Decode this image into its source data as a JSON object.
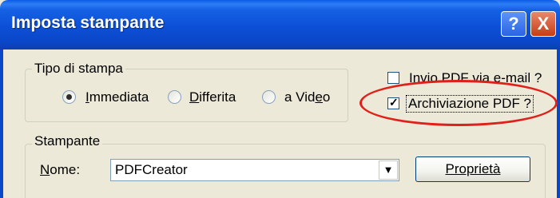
{
  "window": {
    "title": "Imposta stampante",
    "help_symbol": "?",
    "close_symbol": "X"
  },
  "print_type": {
    "label": "Tipo di stampa",
    "options": [
      {
        "label": "Immediata",
        "selected": true
      },
      {
        "label": "Differita",
        "selected": false
      },
      {
        "label": "a Video",
        "selected": false
      }
    ]
  },
  "options": {
    "send_pdf_email": {
      "label": "Invio PDF via e-mail ?",
      "checked": false
    },
    "archive_pdf": {
      "label": "Archiviazione PDF ?",
      "checked": true
    }
  },
  "printer": {
    "group_label": "Stampante",
    "name_label": "Nome:",
    "name_value": "PDFCreator",
    "properties_button": "Proprietà"
  },
  "colors": {
    "annotation": "#E0201A",
    "titlebar": "#0A47C8"
  }
}
